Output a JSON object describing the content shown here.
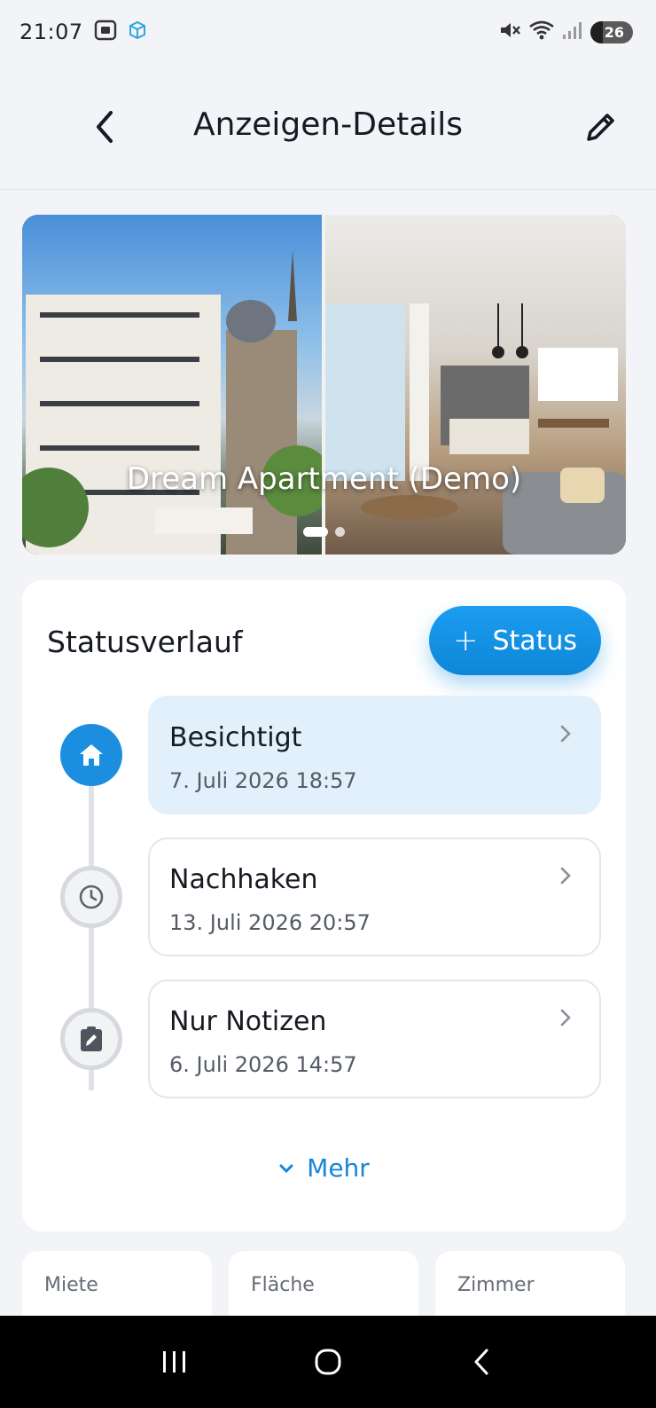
{
  "status_bar": {
    "time": "21:07",
    "battery": "26"
  },
  "header": {
    "title": "Anzeigen-Details",
    "back_icon": "arrow-back-icon",
    "edit_icon": "pencil-icon"
  },
  "hero": {
    "title": "Dream Apartment (Demo)",
    "page_count": 2,
    "current_page": 1
  },
  "status_history": {
    "title": "Statusverlauf",
    "add_button_label": "Status",
    "entries": [
      {
        "label": "Besichtigt",
        "date": "7. Juli 2026 18:57",
        "icon": "home-icon",
        "active": true
      },
      {
        "label": "Nachhaken",
        "date": "13. Juli 2026 20:57",
        "icon": "clock-icon",
        "active": false
      },
      {
        "label": "Nur Notizen",
        "date": "6. Juli 2026 14:57",
        "icon": "note-edit-icon",
        "active": false
      }
    ],
    "more_label": "Mehr"
  },
  "stats": [
    {
      "label": "Miete"
    },
    {
      "label": "Fläche"
    },
    {
      "label": "Zimmer"
    }
  ],
  "colors": {
    "accent": "#1b8ee0",
    "active_entry_bg": "#e2f0fc",
    "background": "#f2f4f7"
  }
}
